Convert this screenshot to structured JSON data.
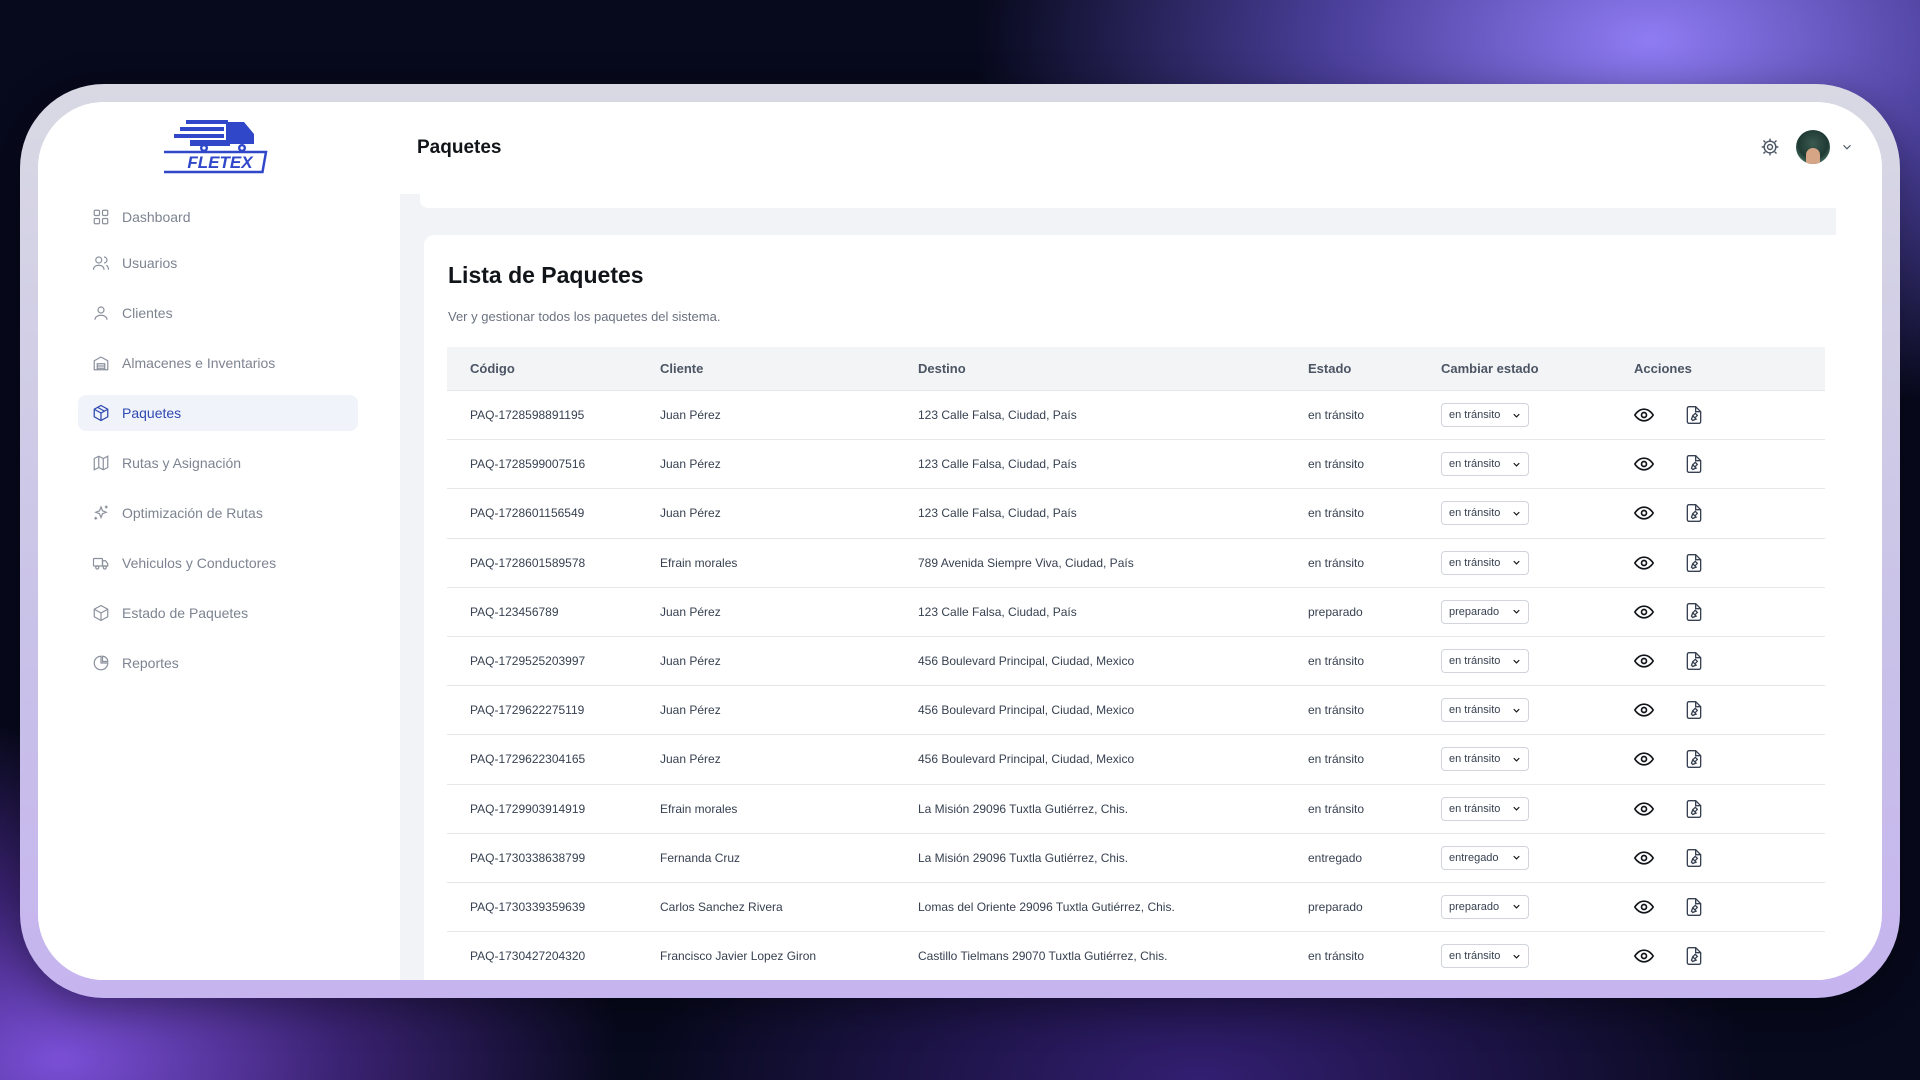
{
  "app": {
    "logo_text": "FLETEX"
  },
  "sidebar": {
    "items": [
      {
        "label": "Dashboard",
        "icon": "grid-icon"
      },
      {
        "label": "Usuarios",
        "icon": "users-icon"
      },
      {
        "label": "Clientes",
        "icon": "user-icon"
      },
      {
        "label": "Almacenes e Inventarios",
        "icon": "warehouse-icon"
      },
      {
        "label": "Paquetes",
        "icon": "package-icon",
        "active": true
      },
      {
        "label": "Rutas y Asignación",
        "icon": "map-icon"
      },
      {
        "label": "Optimización de Rutas",
        "icon": "sparkles-icon"
      },
      {
        "label": "Vehiculos y Conductores",
        "icon": "truck-icon"
      },
      {
        "label": "Estado de Paquetes",
        "icon": "package-check-icon"
      },
      {
        "label": "Reportes",
        "icon": "pie-chart-icon"
      }
    ]
  },
  "header": {
    "title": "Paquetes"
  },
  "card": {
    "title": "Lista de Paquetes",
    "subtitle": "Ver y gestionar todos los paquetes del sistema."
  },
  "table": {
    "headers": [
      "Código",
      "Cliente",
      "Destino",
      "Estado",
      "Cambiar estado",
      "Acciones"
    ],
    "rows": [
      {
        "codigo": "PAQ-1728598891195",
        "cliente": "Juan Pérez",
        "destino": "123 Calle Falsa, Ciudad, País",
        "estado": "en tránsito",
        "cambiar": "en tránsito"
      },
      {
        "codigo": "PAQ-1728599007516",
        "cliente": "Juan Pérez",
        "destino": "123 Calle Falsa, Ciudad, País",
        "estado": "en tránsito",
        "cambiar": "en tránsito"
      },
      {
        "codigo": "PAQ-1728601156549",
        "cliente": "Juan Pérez",
        "destino": "123 Calle Falsa, Ciudad, País",
        "estado": "en tránsito",
        "cambiar": "en tránsito"
      },
      {
        "codigo": "PAQ-1728601589578",
        "cliente": "Efrain morales",
        "destino": "789 Avenida Siempre Viva, Ciudad, País",
        "estado": "en tránsito",
        "cambiar": "en tránsito"
      },
      {
        "codigo": "PAQ-123456789",
        "cliente": "Juan Pérez",
        "destino": "123 Calle Falsa, Ciudad, País",
        "estado": "preparado",
        "cambiar": "preparado"
      },
      {
        "codigo": "PAQ-1729525203997",
        "cliente": "Juan Pérez",
        "destino": "456 Boulevard Principal, Ciudad, Mexico",
        "estado": "en tránsito",
        "cambiar": "en tránsito"
      },
      {
        "codigo": "PAQ-1729622275119",
        "cliente": "Juan Pérez",
        "destino": "456 Boulevard Principal, Ciudad, Mexico",
        "estado": "en tránsito",
        "cambiar": "en tránsito"
      },
      {
        "codigo": "PAQ-1729622304165",
        "cliente": "Juan Pérez",
        "destino": "456 Boulevard Principal, Ciudad, Mexico",
        "estado": "en tránsito",
        "cambiar": "en tránsito"
      },
      {
        "codigo": "PAQ-1729903914919",
        "cliente": "Efrain morales",
        "destino": "La Misión 29096 Tuxtla Gutiérrez, Chis.",
        "estado": "en tránsito",
        "cambiar": "en tránsito"
      },
      {
        "codigo": "PAQ-1730338638799",
        "cliente": "Fernanda Cruz",
        "destino": "La Misión 29096 Tuxtla Gutiérrez, Chis.",
        "estado": "entregado",
        "cambiar": "entregado"
      },
      {
        "codigo": "PAQ-1730339359639",
        "cliente": "Carlos Sanchez Rivera",
        "destino": "Lomas del Oriente 29096 Tuxtla Gutiérrez, Chis.",
        "estado": "preparado",
        "cambiar": "preparado"
      },
      {
        "codigo": "PAQ-1730427204320",
        "cliente": "Francisco Javier Lopez Giron",
        "destino": "Castillo Tielmans 29070 Tuxtla Gutiérrez, Chis.",
        "estado": "en tránsito",
        "cambiar": "en tránsito"
      }
    ]
  },
  "colors": {
    "brand": "#2f4ab0",
    "active_bg": "#f0f3fa"
  }
}
